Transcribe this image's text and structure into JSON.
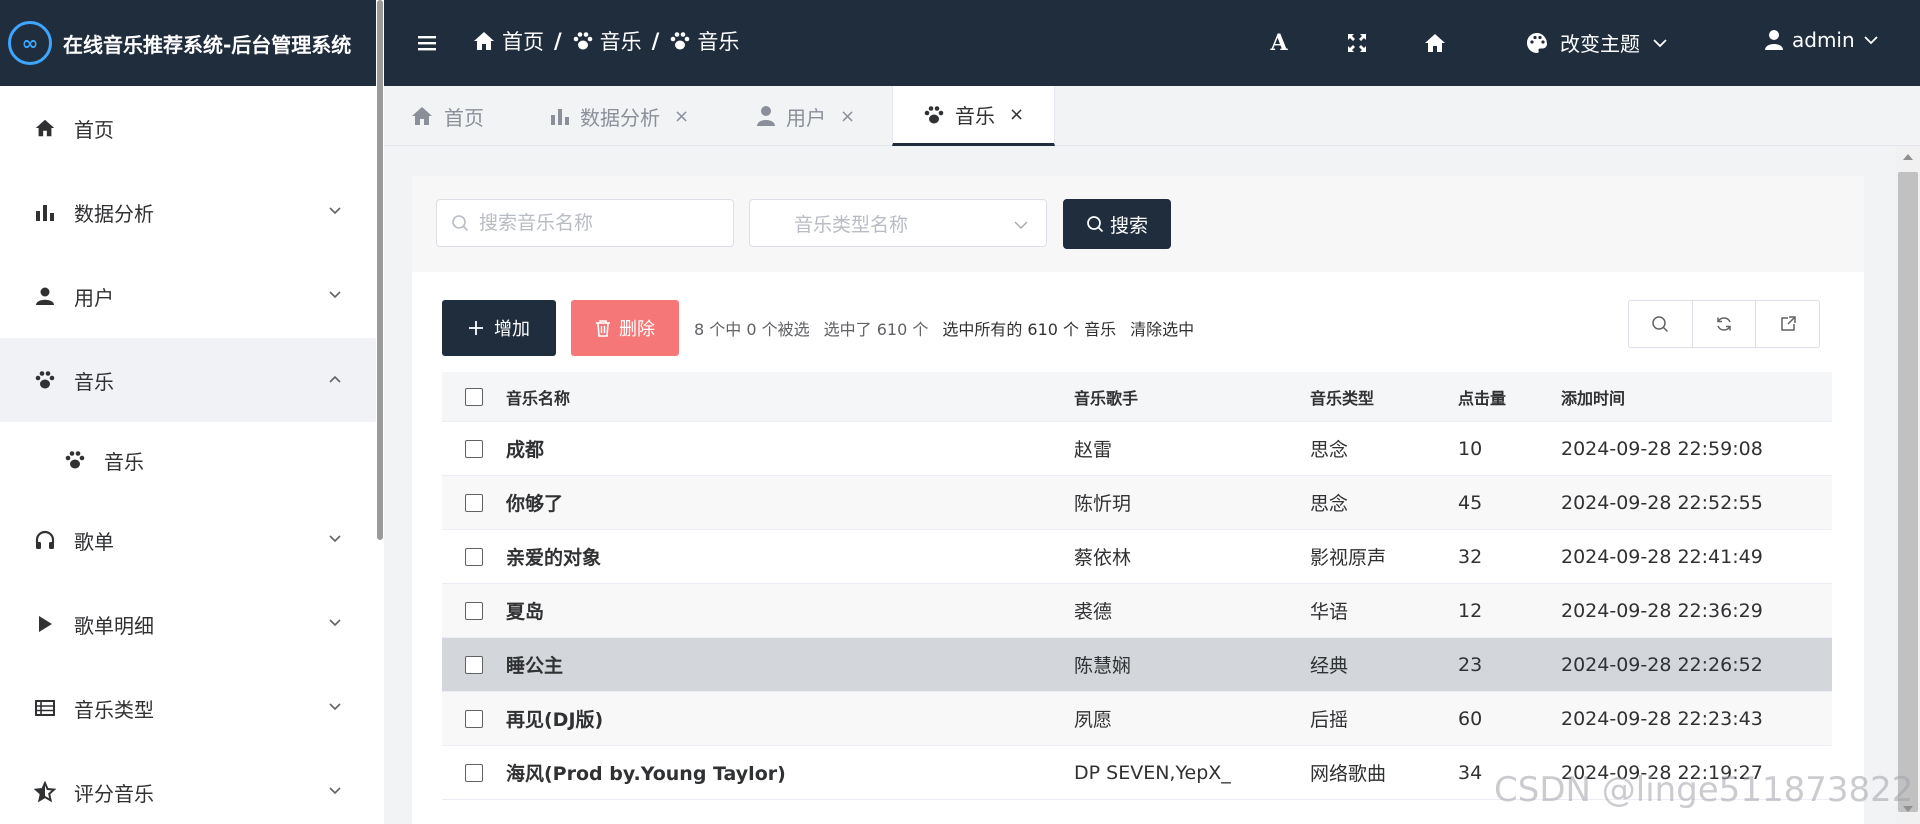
{
  "app": {
    "title": "在线音乐推荐系统-后台管理系统",
    "logo": "∞"
  },
  "sidebar": {
    "items": [
      {
        "label": "首页",
        "icon": "home-icon"
      },
      {
        "label": "数据分析",
        "icon": "bar-chart-icon"
      },
      {
        "label": "用户",
        "icon": "user-icon"
      },
      {
        "label": "音乐",
        "icon": "paw-icon",
        "expanded": true
      },
      {
        "label": "歌单",
        "icon": "headphones-icon"
      },
      {
        "label": "歌单明细",
        "icon": "play-icon"
      },
      {
        "label": "音乐类型",
        "icon": "list-icon"
      },
      {
        "label": "评分音乐",
        "icon": "star-icon"
      }
    ],
    "sub_items": [
      {
        "label": "音乐",
        "icon": "paw-icon"
      }
    ]
  },
  "topbar": {
    "breadcrumbs": [
      "首页",
      "音乐",
      "音乐"
    ],
    "font_tool": "A",
    "theme_label": "改变主题",
    "user_name": "admin"
  },
  "tabs": [
    {
      "label": "首页",
      "closable": false
    },
    {
      "label": "数据分析",
      "closable": true
    },
    {
      "label": "用户",
      "closable": true
    },
    {
      "label": "音乐",
      "closable": true,
      "active": true
    }
  ],
  "tab_close": "×",
  "search": {
    "name_placeholder": "搜索音乐名称",
    "type_placeholder": "音乐类型名称",
    "button_label": "搜索"
  },
  "toolbar": {
    "add_label": "增加",
    "delete_label": "删除",
    "selection_text": "8 个中 0 个被选",
    "selected_count_text": "选中了 610 个",
    "select_all_text": "选中所有的 610 个 音乐",
    "clear_text": "清除选中"
  },
  "table": {
    "columns": [
      "音乐名称",
      "音乐歌手",
      "音乐类型",
      "点击量",
      "添加时间"
    ],
    "rows": [
      {
        "name": "成都",
        "singer": "赵雷",
        "type": "思念",
        "clicks": "10",
        "time": "2024-09-28 22:59:08"
      },
      {
        "name": "你够了",
        "singer": "陈忻玥",
        "type": "思念",
        "clicks": "45",
        "time": "2024-09-28 22:52:55"
      },
      {
        "name": "亲爱的对象",
        "singer": "蔡依林",
        "type": "影视原声",
        "clicks": "32",
        "time": "2024-09-28 22:41:49"
      },
      {
        "name": "夏岛",
        "singer": "裘德",
        "type": "华语",
        "clicks": "12",
        "time": "2024-09-28 22:36:29"
      },
      {
        "name": "睡公主",
        "singer": "陈慧娴",
        "type": "经典",
        "clicks": "23",
        "time": "2024-09-28 22:26:52"
      },
      {
        "name": "再见(DJ版)",
        "singer": "夙愿",
        "type": "后摇",
        "clicks": "60",
        "time": "2024-09-28 22:23:43"
      },
      {
        "name": "海风(Prod by.Young Taylor)",
        "singer": "DP SEVEN,YepX_",
        "type": "网络歌曲",
        "clicks": "34",
        "time": "2024-09-28 22:19:27"
      }
    ]
  },
  "watermark": "CSDN @linge511873822",
  "colors": {
    "dark": "#1f2d3d",
    "danger": "#f56c6c",
    "accent": "#3ea6ff"
  }
}
